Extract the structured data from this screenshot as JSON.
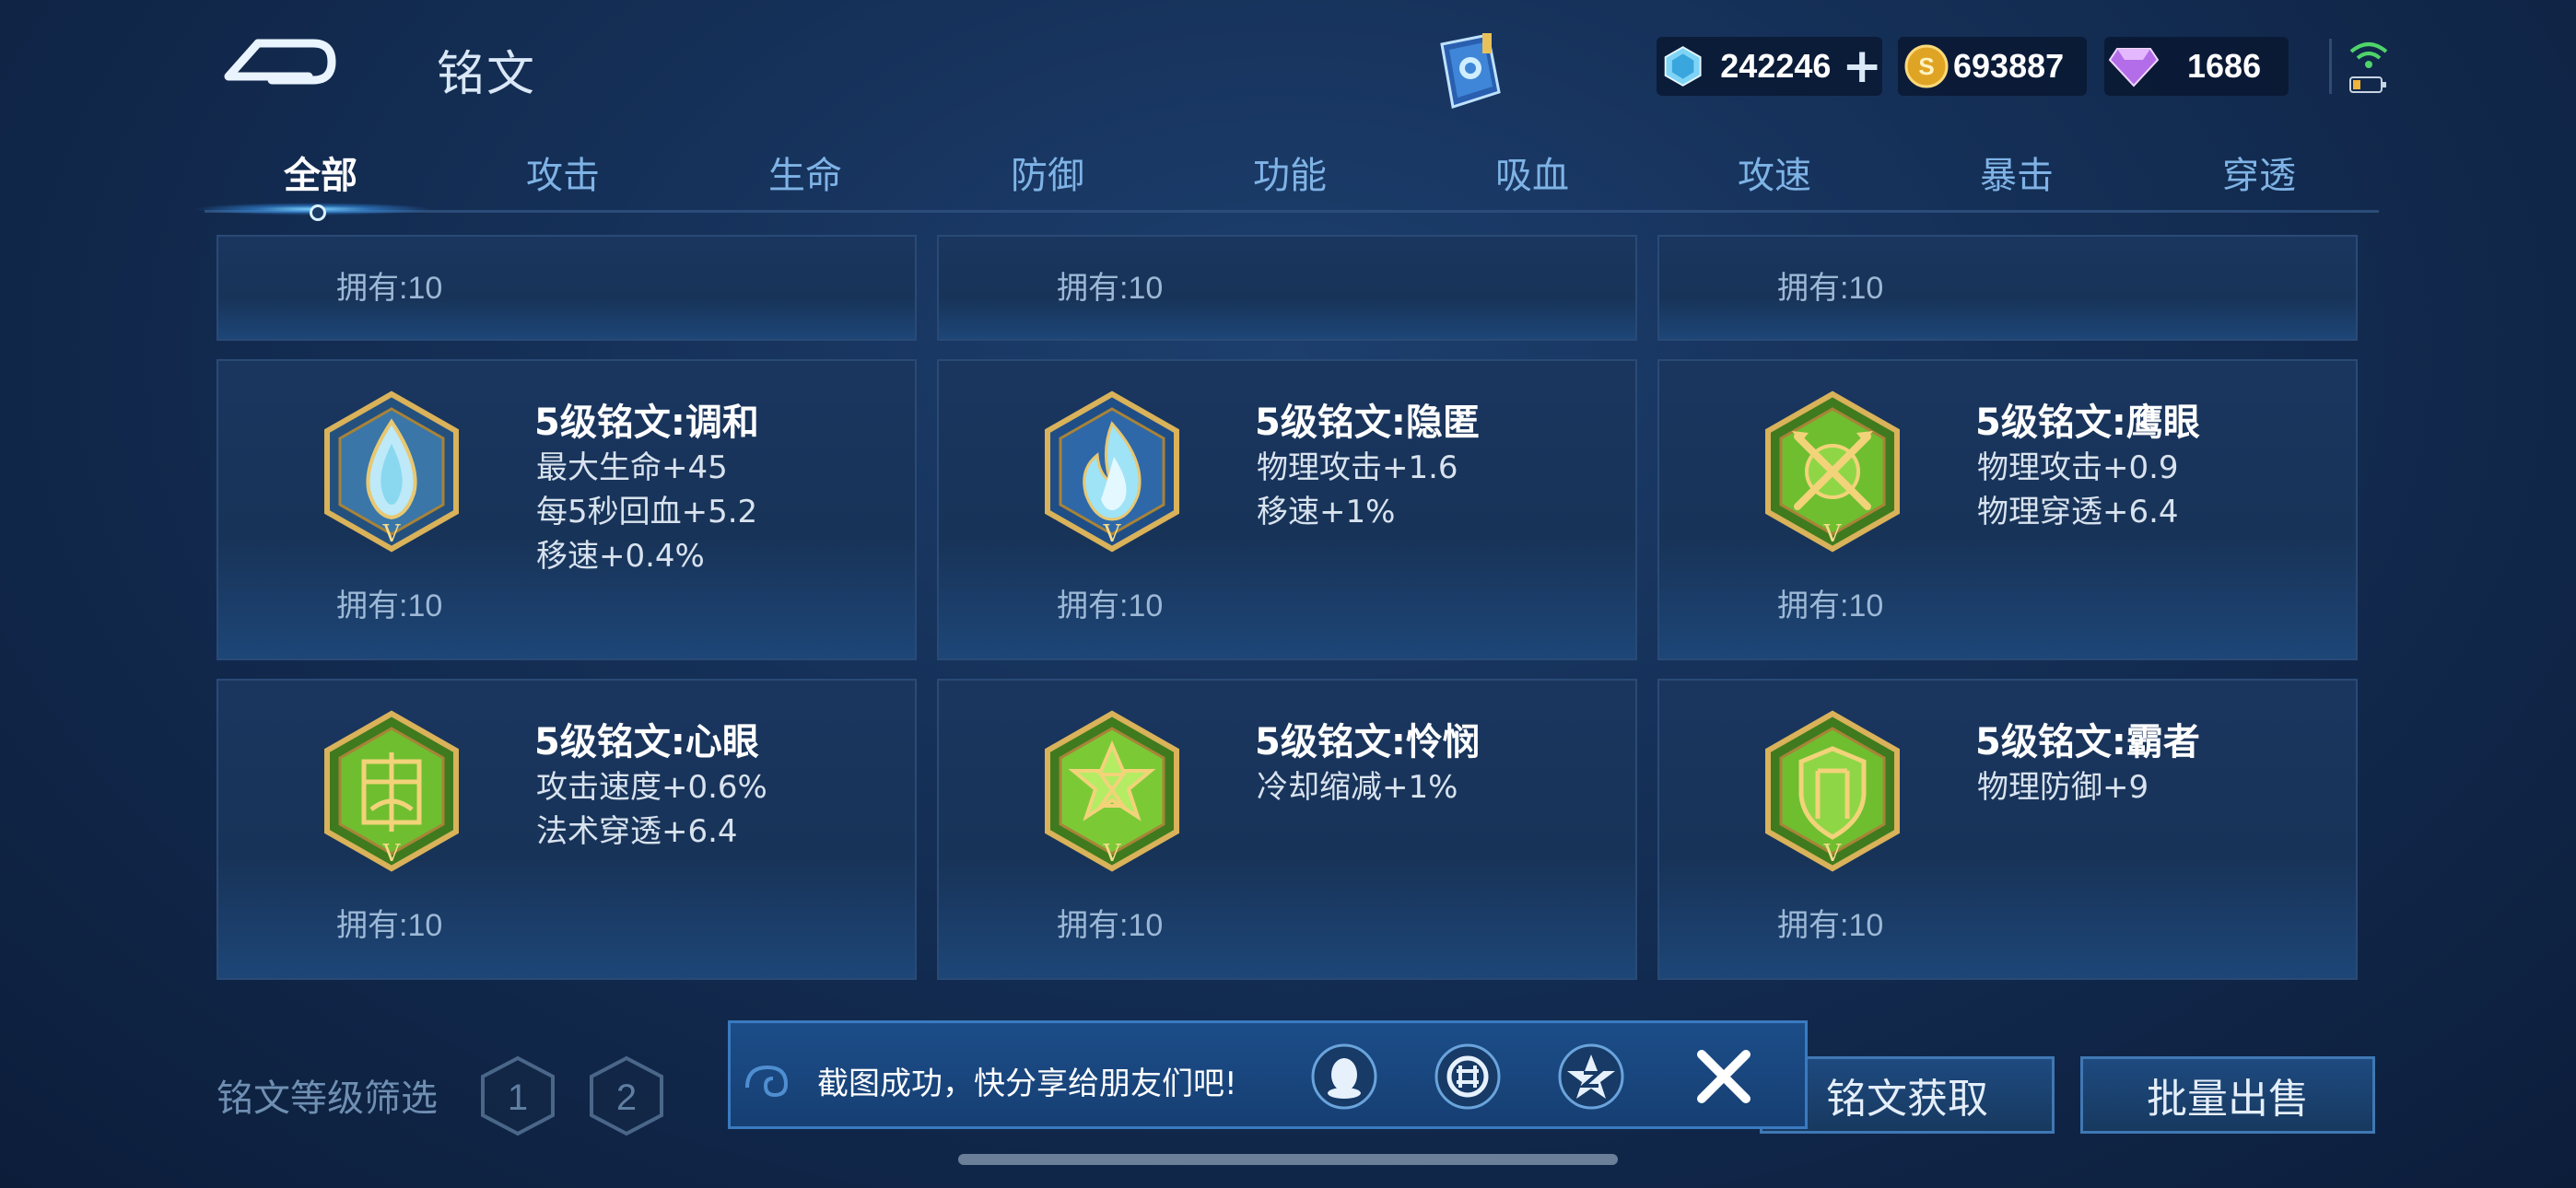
{
  "header": {
    "title": "铭文",
    "currencies": [
      {
        "name": "diamond-coupon",
        "value": "242246",
        "icon": "blue-diamond-icon",
        "has_plus": true
      },
      {
        "name": "gold",
        "value": "693887",
        "icon": "gold-coin-icon",
        "has_plus": false
      },
      {
        "name": "gem",
        "value": "1686",
        "icon": "purple-gem-icon",
        "has_plus": false
      }
    ],
    "plus_symbol": "+"
  },
  "tabs": [
    {
      "label": "全部",
      "active": true
    },
    {
      "label": "攻击"
    },
    {
      "label": "生命"
    },
    {
      "label": "防御"
    },
    {
      "label": "功能"
    },
    {
      "label": "吸血"
    },
    {
      "label": "攻速"
    },
    {
      "label": "暴击"
    },
    {
      "label": "穿透"
    }
  ],
  "top_row_owned": [
    "拥有:10",
    "拥有:10",
    "拥有:10"
  ],
  "cards": [
    {
      "title": "5级铭文:调和",
      "stats": [
        "最大生命+45",
        "每5秒回血+5.2",
        "移速+0.4%"
      ],
      "owned": "拥有:10",
      "emblem": "water-drop-icon",
      "color": "#8ad8f0"
    },
    {
      "title": "5级铭文:隐匿",
      "stats": [
        "物理攻击+1.6",
        "移速+1%"
      ],
      "owned": "拥有:10",
      "emblem": "blue-flame-icon",
      "color": "#6ec8ee"
    },
    {
      "title": "5级铭文:鹰眼",
      "stats": [
        "物理攻击+0.9",
        "物理穿透+6.4"
      ],
      "owned": "拥有:10",
      "emblem": "crossed-arrows-icon",
      "color": "#6fbe2f"
    },
    {
      "title": "5级铭文:心眼",
      "stats": [
        "攻击速度+0.6%",
        "法术穿透+6.4"
      ],
      "owned": "拥有:10",
      "emblem": "leaf-sigil-icon",
      "color": "#6fbe2f"
    },
    {
      "title": "5级铭文:怜悯",
      "stats": [
        "冷却缩减+1%"
      ],
      "owned": "拥有:10",
      "emblem": "star-hourglass-icon",
      "color": "#7cc936"
    },
    {
      "title": "5级铭文:霸者",
      "stats": [
        "物理防御+9"
      ],
      "owned": "拥有:10",
      "emblem": "shield-icon",
      "color": "#6fbe2f"
    }
  ],
  "emblem_level_mark": "V",
  "bottom": {
    "filter_label": "铭文等级筛选",
    "levels": [
      "1",
      "2"
    ],
    "obtain_button": "铭文获取",
    "sell_button": "批量出售"
  },
  "toast": {
    "message": "截图成功，快分享给朋友们吧!",
    "share_targets": [
      "qq-icon",
      "wechat-moments-icon",
      "qzone-icon"
    ],
    "close": "✕"
  }
}
